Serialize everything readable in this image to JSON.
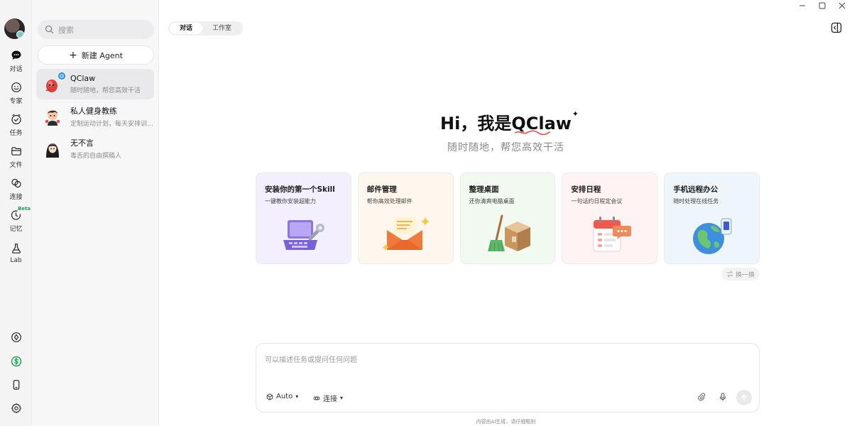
{
  "window_controls": [
    "minimize",
    "maximize",
    "close"
  ],
  "rail": {
    "items": [
      {
        "label": "对话",
        "icon": "chat-bubble-icon"
      },
      {
        "label": "专家",
        "icon": "smiley-face-icon"
      },
      {
        "label": "任务",
        "icon": "clock-check-icon"
      },
      {
        "label": "文件",
        "icon": "folder-icon"
      },
      {
        "label": "连接",
        "icon": "link-icon"
      },
      {
        "label": "记忆",
        "icon": "memory-icon",
        "badge": "Beta"
      },
      {
        "label": "Lab",
        "icon": "flask-icon"
      }
    ],
    "bottom_icons": [
      "compass-icon",
      "dollar-coin-icon",
      "phone-icon",
      "settings-icon"
    ]
  },
  "sidebar": {
    "search_placeholder": "搜索",
    "new_agent_label": "新建 Agent",
    "agents": [
      {
        "name": "QClaw",
        "subtitle": "随时随地，帮您高效干活",
        "active": true
      },
      {
        "name": "私人健身教练",
        "subtitle": "定制运动计划，每天安排训…",
        "active": false
      },
      {
        "name": "无不言",
        "subtitle": "毒舌的自由撰稿人",
        "active": false
      }
    ]
  },
  "main": {
    "tabs": [
      {
        "label": "对话",
        "active": true
      },
      {
        "label": "工作室",
        "active": false
      }
    ],
    "hero": {
      "greeting": "Hi，我是",
      "brand": "QClaw",
      "subtitle": "随时随地，帮您高效干活"
    },
    "cards": [
      {
        "title": "安装你的第一个Skill",
        "desc": "一键教你安装超能力",
        "bg": "#f3efff",
        "illustration": "laptop-wrench-icon"
      },
      {
        "title": "邮件管理",
        "desc": "帮你高效处理邮件",
        "bg": "#fff6ee",
        "illustration": "envelope-icon"
      },
      {
        "title": "整理桌面",
        "desc": "还你清爽电脑桌面",
        "bg": "#f1f9f1",
        "illustration": "broom-box-icon"
      },
      {
        "title": "安排日程",
        "desc": "一句话约日程定会议",
        "bg": "#fff3f3",
        "illustration": "calendar-icon"
      },
      {
        "title": "手机远程办公",
        "desc": "随时处理在线任务",
        "bg": "#eef6fc",
        "illustration": "globe-phone-icon"
      }
    ],
    "shuffle_label": "换一换",
    "composer": {
      "placeholder": "可以描述任务或提问任何问题",
      "model_label": "Auto",
      "connect_label": "连接"
    },
    "disclaimer": "内容由AI生成，请仔细甄别"
  }
}
